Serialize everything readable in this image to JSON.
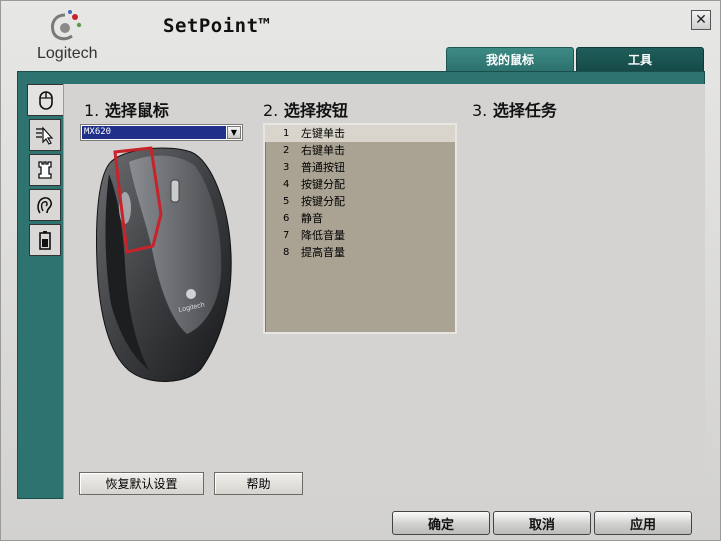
{
  "app": {
    "title": "SetPoint™",
    "brand": "Logitech",
    "close_label": "✕"
  },
  "tabs": [
    {
      "label": "我的鼠标",
      "active": true
    },
    {
      "label": "工具",
      "active": false
    }
  ],
  "side_tabs": [
    {
      "icon": "mouse-icon",
      "active": true
    },
    {
      "icon": "pointer-icon",
      "active": false
    },
    {
      "icon": "chess-rook-icon",
      "active": false
    },
    {
      "icon": "ear-sound-icon",
      "active": false
    },
    {
      "icon": "battery-icon",
      "active": false
    }
  ],
  "steps": {
    "step1": {
      "num": "1.",
      "label": "选择鼠标"
    },
    "step2": {
      "num": "2.",
      "label": "选择按钮"
    },
    "step3": {
      "num": "3.",
      "label": "选择任务"
    }
  },
  "mouse_select": {
    "value": "MX620",
    "arrow": "▼"
  },
  "button_list": [
    {
      "idx": "1",
      "label": "左键单击",
      "selected": true
    },
    {
      "idx": "2",
      "label": "右键单击",
      "selected": false
    },
    {
      "idx": "3",
      "label": "普通按钮",
      "selected": false
    },
    {
      "idx": "4",
      "label": "按键分配",
      "selected": false
    },
    {
      "idx": "5",
      "label": "按键分配",
      "selected": false
    },
    {
      "idx": "6",
      "label": "静音",
      "selected": false
    },
    {
      "idx": "7",
      "label": "降低音量",
      "selected": false
    },
    {
      "idx": "8",
      "label": "提高音量",
      "selected": false
    }
  ],
  "actions": {
    "restore_defaults": "恢复默认设置",
    "help": "帮助"
  },
  "footer": {
    "ok": "确定",
    "cancel": "取消",
    "apply": "应用"
  },
  "colors": {
    "teal_frame": "#2e7370",
    "tab_active": "#2c716d",
    "selection_blue": "#1f2f8a",
    "highlight_red": "#c8232a"
  }
}
